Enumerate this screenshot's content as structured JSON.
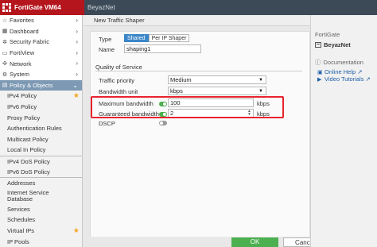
{
  "header": {
    "title": "FortiGate VM64",
    "hostname": "BeyazNet"
  },
  "sidebar": {
    "items": [
      {
        "label": "Favorites",
        "icon": "star-icon"
      },
      {
        "label": "Dashboard",
        "icon": "dashboard-icon"
      },
      {
        "label": "Security Fabric",
        "icon": "fabric-icon"
      },
      {
        "label": "FortiView",
        "icon": "fortiview-icon"
      },
      {
        "label": "Network",
        "icon": "network-icon"
      },
      {
        "label": "System",
        "icon": "gear-icon"
      },
      {
        "label": "Policy & Objects",
        "icon": "policy-icon"
      }
    ],
    "subitems": [
      "IPv4 Policy",
      "IPv6 Policy",
      "Proxy Policy",
      "Authentication Rules",
      "Multicast Policy",
      "Local In Policy",
      "IPv4 DoS Policy",
      "IPv6 DoS Policy",
      "Addresses",
      "Internet Service Database",
      "Services",
      "Schedules",
      "Virtual IPs",
      "IP Pools"
    ]
  },
  "main": {
    "breadcrumb": "New Traffic Shaper",
    "type_label": "Type",
    "type_options": [
      "Shared",
      "Per IP Shaper"
    ],
    "type_selected": "Shared",
    "name_label": "Name",
    "name_value": "shaping1",
    "qos_heading": "Quality of Service",
    "traffic_priority_label": "Traffic priority",
    "traffic_priority_value": "Medium",
    "bandwidth_unit_label": "Bandwidth unit",
    "bandwidth_unit_value": "kbps",
    "max_bw_label": "Maximum bandwidth",
    "max_bw_value": "100",
    "max_bw_unit": "kbps",
    "max_bw_enabled": true,
    "guar_bw_label": "Guaranteed bandwidth",
    "guar_bw_value": "2",
    "guar_bw_unit": "kbps",
    "guar_bw_enabled": true,
    "dscp_label": "DSCP",
    "dscp_enabled": false,
    "ok_label": "OK",
    "cancel_label": "Cancel"
  },
  "info": {
    "title": "FortiGate",
    "hostname": "BeyazNet",
    "doc_heading": "Documentation",
    "links": [
      "Online Help",
      "Video Tutorials"
    ]
  },
  "colors": {
    "brand": "#b5161e",
    "accent": "#3a86c8",
    "ok": "#4caf50",
    "highlight": "#e8232d"
  }
}
